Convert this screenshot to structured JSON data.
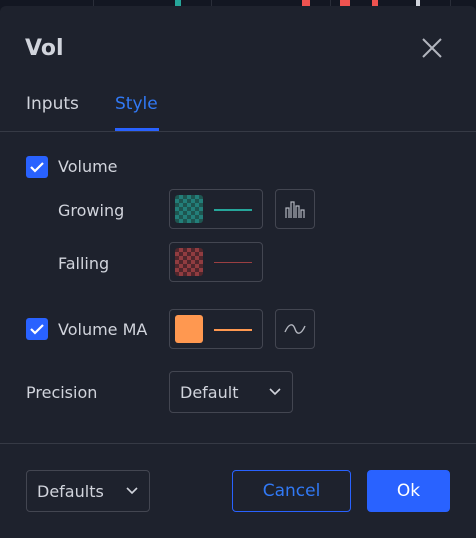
{
  "dialog": {
    "title": "Vol"
  },
  "tabs": [
    {
      "label": "Inputs",
      "active": false
    },
    {
      "label": "Style",
      "active": true
    }
  ],
  "style": {
    "volume": {
      "label": "Volume",
      "checked": true,
      "growing": {
        "label": "Growing",
        "color": "#26a69a"
      },
      "falling": {
        "label": "Falling",
        "color": "#ef5350"
      }
    },
    "volume_ma": {
      "label": "Volume MA",
      "checked": true,
      "color": "#ff9850"
    },
    "precision": {
      "label": "Precision",
      "value": "Default"
    }
  },
  "footer": {
    "defaults_label": "Defaults",
    "cancel_label": "Cancel",
    "ok_label": "Ok"
  },
  "icons": {
    "close": "close-icon",
    "plot_style": "bar-columns-icon",
    "line_style": "wave-line-icon",
    "chevron": "chevron-down-icon",
    "check": "checkmark-icon"
  },
  "colors": {
    "accent": "#2962ff",
    "background": "#1e222d",
    "border": "#434651"
  }
}
